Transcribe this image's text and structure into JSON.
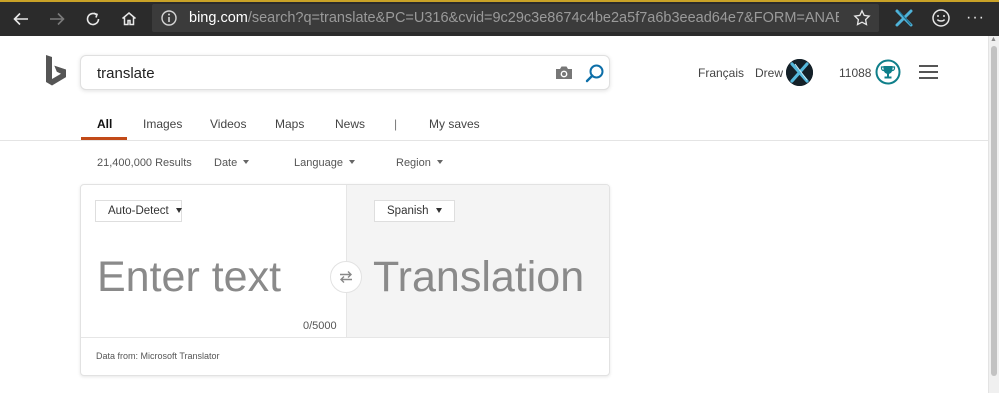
{
  "browser": {
    "url_host": "bing.com",
    "url_path": "/search?q=translate&PC=U316&cvid=9c29c3e8674c4be2a5f7a6b3eead64e7&FORM=ANAB01&setLan...",
    "more_label": "···",
    "accent_color": "#c9a227"
  },
  "search": {
    "query": "translate"
  },
  "header": {
    "language_link": "Français",
    "user_name": "Drew",
    "points": "11088",
    "rewards_color": "#0f7f8a"
  },
  "tabs": [
    {
      "label": "All",
      "active": true
    },
    {
      "label": "Images",
      "active": false
    },
    {
      "label": "Videos",
      "active": false
    },
    {
      "label": "Maps",
      "active": false
    },
    {
      "label": "News",
      "active": false
    },
    {
      "label": "My saves",
      "active": false
    }
  ],
  "tab_separator": "|",
  "filters": {
    "results": "21,400,000 Results",
    "date": "Date",
    "language": "Language",
    "region": "Region"
  },
  "translator": {
    "source_language": "Auto-Detect",
    "target_language": "Spanish",
    "input_placeholder": "Enter text",
    "output_placeholder": "Translation",
    "char_count": "0/5000",
    "attribution": "Data from: Microsoft Translator"
  },
  "colors": {
    "tab_active_underline": "#c24a18",
    "bing_blue": "#0c6ea8"
  }
}
